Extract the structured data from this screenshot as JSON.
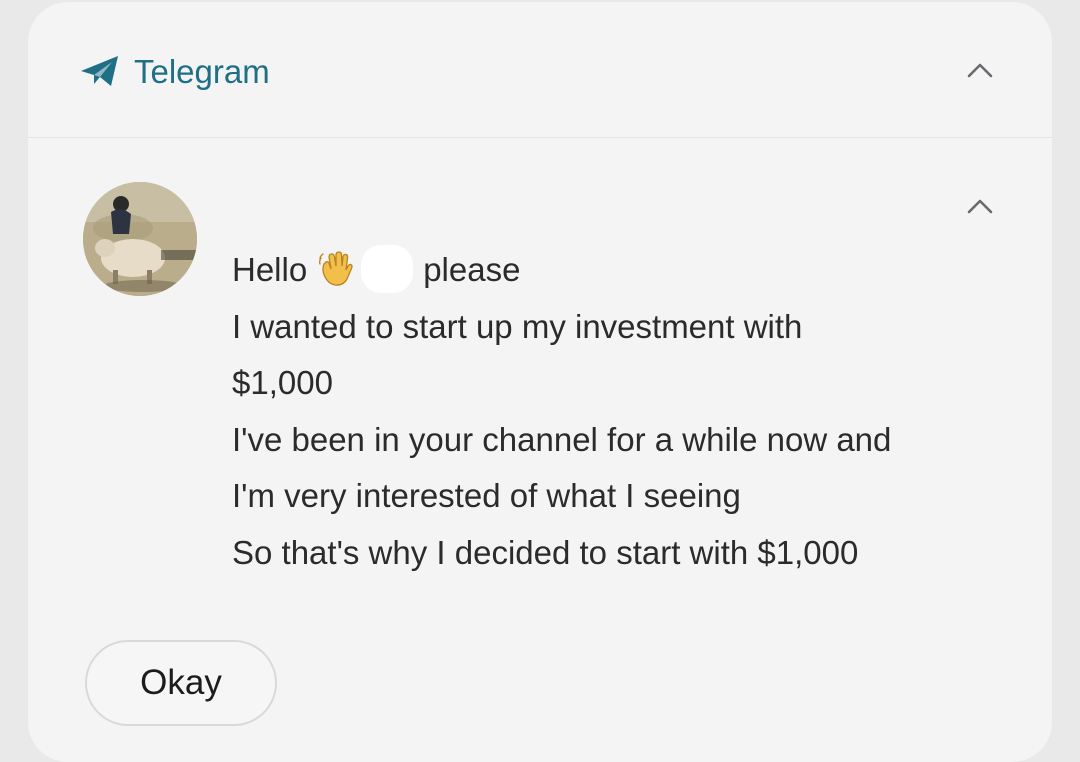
{
  "notification": {
    "app_name": "Telegram",
    "app_icon": "telegram-send-icon",
    "accent_color": "#1f6f86",
    "collapse_icon": "chevron-up-icon"
  },
  "message": {
    "avatar_icon": "sender-avatar",
    "greeting": "Hello",
    "greeting_emoji": "waving-hand-icon",
    "greeting_suffix": "please",
    "lines": [
      "I wanted to start up my investment with",
      "$1,000",
      "I've been in your channel for a while now and",
      "I'm very interested of what I seeing",
      "So that's why I decided to start with $1,000"
    ],
    "collapse_icon": "chevron-up-icon"
  },
  "actions": {
    "okay_label": "Okay"
  }
}
